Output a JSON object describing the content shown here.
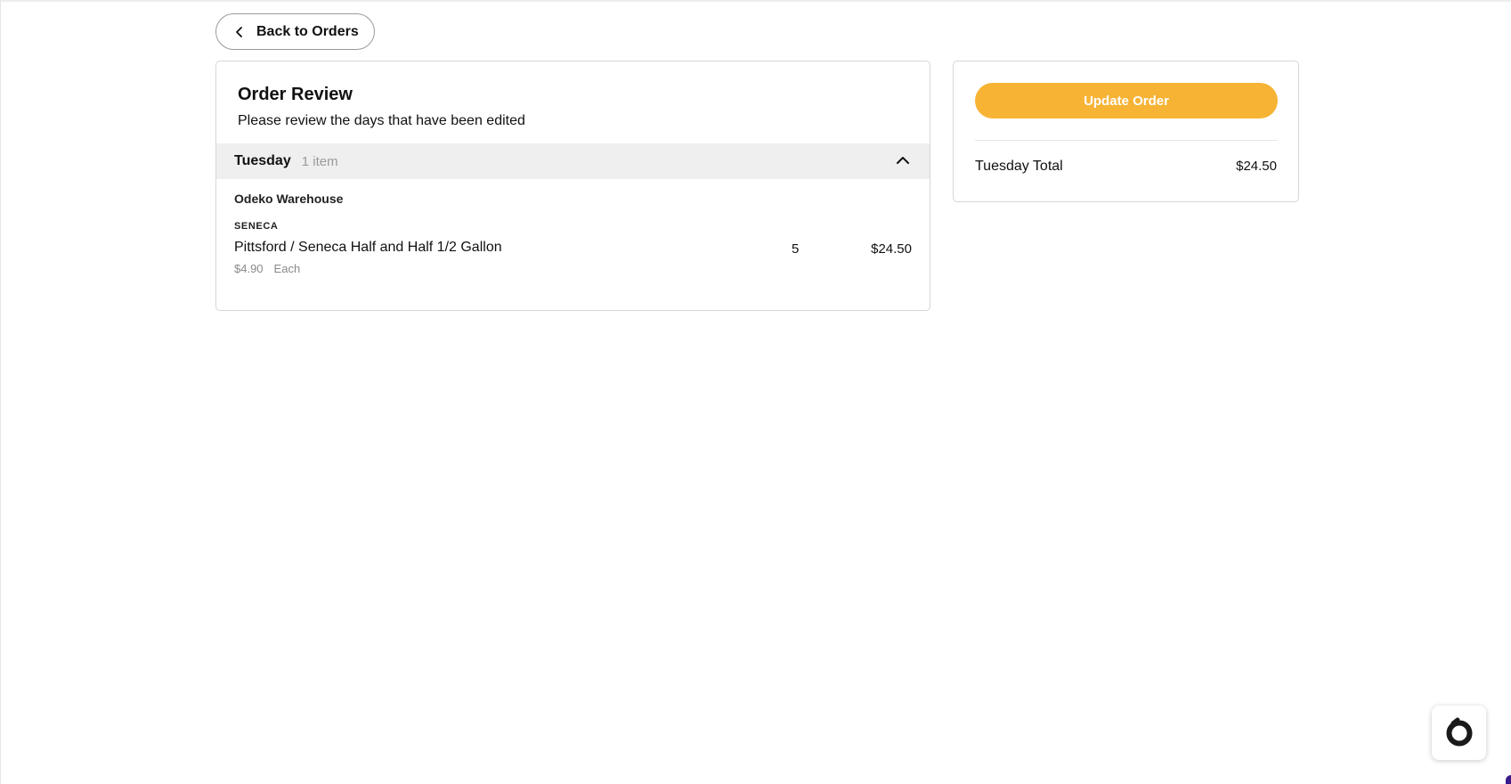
{
  "nav": {
    "back_label": "Back to Orders"
  },
  "review": {
    "title": "Order Review",
    "subtitle": "Please review the days that have been edited",
    "day": {
      "name": "Tuesday",
      "item_count": "1 item"
    },
    "vendor": "Odeko Warehouse",
    "items": [
      {
        "brand": "SENECA",
        "name": "Pittsford / Seneca Half and Half 1/2 Gallon",
        "unit_price": "$4.90",
        "unit": "Each",
        "quantity": "5",
        "total": "$24.50"
      }
    ]
  },
  "summary": {
    "update_label": "Update Order",
    "total_label": "Tuesday Total",
    "total_value": "$24.50"
  },
  "colors": {
    "accent": "#f7b334",
    "day_header_bg": "#efefef",
    "muted_text": "#9a9a9a"
  },
  "icons": {
    "back": "chevron-left-icon",
    "collapse": "chevron-up-icon",
    "widget": "odeko-ring-icon"
  }
}
